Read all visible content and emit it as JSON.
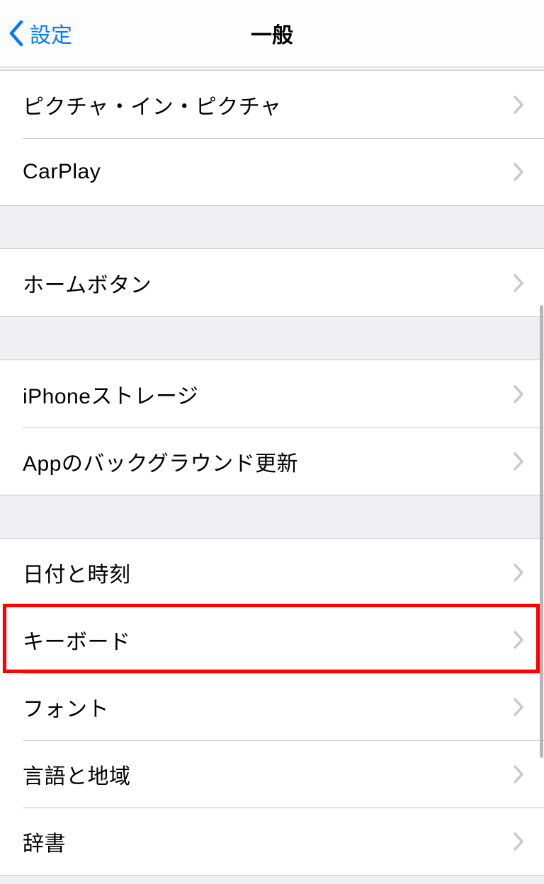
{
  "nav": {
    "back_label": "設定",
    "title": "一般"
  },
  "groups": [
    {
      "id": "g1",
      "items": [
        {
          "id": "pip",
          "label": "ピクチャ・イン・ピクチャ"
        },
        {
          "id": "carplay",
          "label": "CarPlay"
        }
      ]
    },
    {
      "id": "g2",
      "items": [
        {
          "id": "homebutton",
          "label": "ホームボタン"
        }
      ]
    },
    {
      "id": "g3",
      "items": [
        {
          "id": "storage",
          "label": "iPhoneストレージ"
        },
        {
          "id": "bgapp",
          "label": "Appのバックグラウンド更新"
        }
      ]
    },
    {
      "id": "g4",
      "items": [
        {
          "id": "datetime",
          "label": "日付と時刻"
        },
        {
          "id": "keyboard",
          "label": "キーボード",
          "highlighted": true
        },
        {
          "id": "fonts",
          "label": "フォント"
        },
        {
          "id": "language",
          "label": "言語と地域"
        },
        {
          "id": "dict",
          "label": "辞書"
        }
      ]
    }
  ]
}
